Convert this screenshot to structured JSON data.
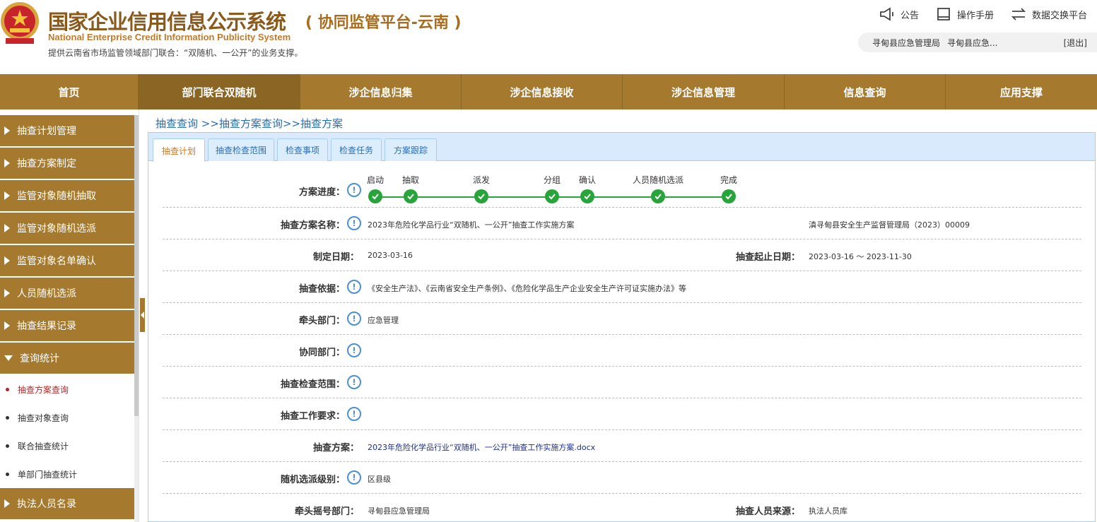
{
  "header": {
    "title": "国家企业信用信息公示系统",
    "subtitle": "( 协同监管平台-云南 )",
    "english": "National Enterprise Credit Information Publicity System",
    "desc": "提供云南省市场监管领域部门联合：“双随机、一公开”的业务支撑。",
    "links": [
      {
        "label": "公告",
        "icon": "announcement-icon"
      },
      {
        "label": "操作手册",
        "icon": "manual-icon"
      },
      {
        "label": "数据交换平台",
        "icon": "exchange-icon"
      }
    ],
    "user": {
      "org": "寻甸县应急管理局",
      "name": "寻甸县应急...",
      "logout": "[退出]"
    }
  },
  "nav": [
    "首页",
    "部门联合双随机",
    "涉企信息归集",
    "涉企信息接收",
    "涉企信息管理",
    "信息查询",
    "应用支撑"
  ],
  "nav_active": 1,
  "sidebar": {
    "items": [
      "抽查计划管理",
      "抽查方案制定",
      "监管对象随机抽取",
      "监管对象随机选派",
      "监管对象名单确认",
      "人员随机选派",
      "抽查结果记录",
      "查询统计"
    ],
    "sub_items": [
      "抽查方案查询",
      "抽查对象查询",
      "联合抽查统计",
      "单部门抽查统计"
    ],
    "bottom_item": "执法人员名录"
  },
  "breadcrumb": "抽查查询 >>抽查方案查询>>抽查方案",
  "tabs": [
    "抽查计划",
    "抽查检查范围",
    "检查事项",
    "检查任务",
    "方案跟踪"
  ],
  "progress": {
    "label": "方案进度：",
    "steps": [
      "启动",
      "抽取",
      "派发",
      "分组",
      "确认",
      "人员随机选派",
      "完成"
    ]
  },
  "fields": {
    "plan_name_label": "抽查方案名称：",
    "plan_name": "2023年危险化学品行业“双随机、一公开”抽查工作实施方案",
    "plan_code": "滇寻甸县安全生产监督管理局（2023）00009",
    "date_label": "制定日期：",
    "date": "2023-03-16",
    "range_label": "抽查起止日期：",
    "range": "2023-03-16 ～ 2023-11-30",
    "basis_label": "抽查依据：",
    "basis": "《安全生产法》、《云南省安全生产条例》、《危险化学品生产企业安全生产许可证实施办法》等",
    "lead_label": "牵头部门：",
    "lead": "应急管理",
    "coop_label": "协同部门：",
    "scope_label": "抽查检查范围：",
    "req_label": "抽查工作要求：",
    "plan_file_label": "抽查方案：",
    "plan_file": "2023年危险化学品行业“双随机、一公开”抽查工作实施方案.docx",
    "level_label": "随机选派级别：",
    "level": "区县级",
    "lottery_label": "牵头摇号部门：",
    "lottery": "寻甸县应急管理局",
    "source_label": "抽查人员来源：",
    "source": "执法人员库"
  },
  "colors": {
    "nav": "#a57a2e",
    "nav_active": "#8b6523",
    "step": "#27a53a",
    "link": "#2a6db5"
  }
}
